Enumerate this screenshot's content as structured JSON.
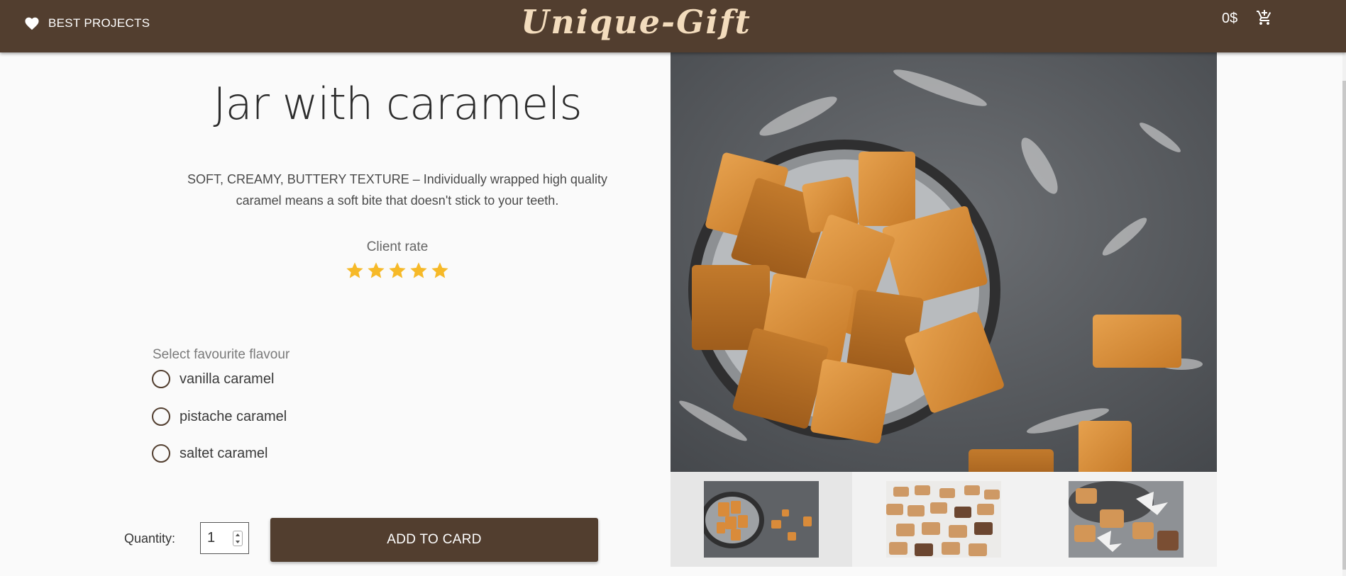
{
  "header": {
    "best_label": "BEST PROJECTS",
    "logo": "Unique-Gift",
    "cart_total": "0$",
    "heart_icon": "heart-icon",
    "cart_icon": "cart-add-icon",
    "bg_color": "#523e2f"
  },
  "product": {
    "title": "Jar with caramels",
    "description": "SOFT, CREAMY, BUTTERY TEXTURE – Individually wrapped high quality caramel means a soft bite that doesn't stick to your teeth.",
    "rating_label": "Client rate",
    "rating": 5,
    "rating_max": 5,
    "star_color": "#f6b928"
  },
  "flavour": {
    "label": "Select favourite flavour",
    "options": [
      "vanilla caramel",
      "pistache caramel",
      "saltet caramel"
    ]
  },
  "purchase": {
    "quantity_label": "Quantity:",
    "quantity": "1",
    "add_label": "ADD TO CARD"
  },
  "gallery": {
    "thumbnails": 3,
    "active_index": 0
  }
}
